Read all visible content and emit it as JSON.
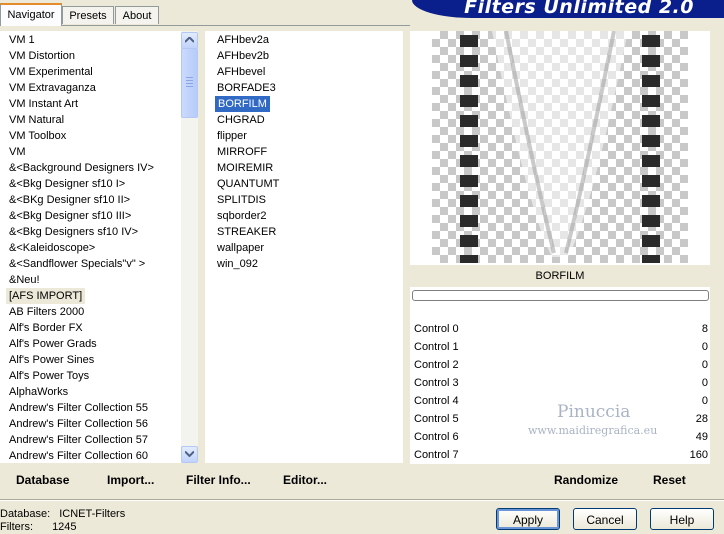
{
  "tabs": [
    "Navigator",
    "Presets",
    "About"
  ],
  "banner_title": "Filters Unlimited 2.0",
  "categories": [
    "VM 1",
    "VM Distortion",
    "VM Experimental",
    "VM Extravaganza",
    "VM Instant Art",
    "VM Natural",
    "VM Toolbox",
    "VM",
    "&<Background Designers IV>",
    "&<Bkg Designer sf10 I>",
    "&<BKg Designer sf10 II>",
    "&<Bkg Designer sf10 III>",
    "&<Bkg Designers sf10 IV>",
    "&<Kaleidoscope>",
    "&<Sandflower Specials\"v\" >",
    "&Neu!",
    "[AFS IMPORT]",
    "AB Filters 2000",
    "Alf's Border FX",
    "Alf's Power Grads",
    "Alf's Power Sines",
    "Alf's Power Toys",
    "AlphaWorks",
    "Andrew's Filter Collection 55",
    "Andrew's Filter Collection 56",
    "Andrew's Filter Collection 57",
    "Andrew's Filter Collection 60"
  ],
  "selected_category": "[AFS IMPORT]",
  "filters": [
    "AFHbev2a",
    "AFHbev2b",
    "AFHbevel",
    "BORFADE3",
    "BORFILM",
    "CHGRAD",
    "flipper",
    "MIRROFF",
    "MOIREMIR",
    "QUANTUMT",
    "SPLITDIS",
    "sqborder2",
    "STREAKER",
    "wallpaper",
    "win_092"
  ],
  "selected_filter": "BORFILM",
  "preview_name": "BORFILM",
  "controls": [
    {
      "label": "Control 0",
      "value": "8"
    },
    {
      "label": "Control 1",
      "value": "0"
    },
    {
      "label": "Control 2",
      "value": "0"
    },
    {
      "label": "Control 3",
      "value": "0"
    },
    {
      "label": "Control 4",
      "value": "0"
    },
    {
      "label": "Control 5",
      "value": "28"
    },
    {
      "label": "Control 6",
      "value": "49"
    },
    {
      "label": "Control 7",
      "value": "160"
    }
  ],
  "watermark": {
    "line1": "Pinuccia",
    "line2": "www.maidiregrafica.eu"
  },
  "actions": {
    "database": "Database",
    "import": "Import...",
    "filter_info": "Filter Info...",
    "editor": "Editor...",
    "randomize": "Randomize",
    "reset": "Reset"
  },
  "status": {
    "database_label": "Database:",
    "database_value": "ICNET-Filters",
    "filters_label": "Filters:",
    "filters_value": "1245"
  },
  "buttons": {
    "apply": "Apply",
    "cancel": "Cancel",
    "help": "Help"
  },
  "colors": {
    "selection": "#316ac5",
    "banner": "#0a1e8c",
    "tab_accent": "#e68b2c"
  }
}
